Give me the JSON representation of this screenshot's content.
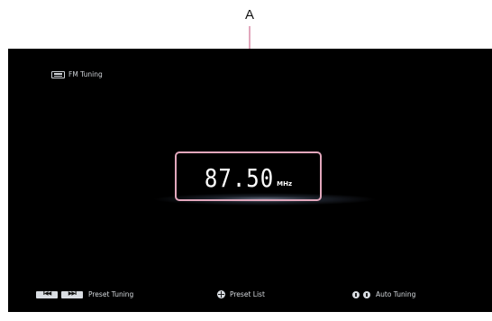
{
  "callout": {
    "letter": "A"
  },
  "mode": {
    "icon": "fm-tuner-icon",
    "label": "FM Tuning"
  },
  "frequency": {
    "value": "87.50",
    "unit": "MHz"
  },
  "footer": {
    "preset_tuning": {
      "keys": [
        "skip-previous-icon",
        "skip-next-icon"
      ],
      "key_glyphs": [
        "I◀◀",
        "▶▶I"
      ],
      "label": "Preset Tuning"
    },
    "preset_list": {
      "icon": "directional-pad-icon",
      "label": "Preset List"
    },
    "auto_tuning": {
      "icons": [
        "tune-down-button-icon",
        "tune-up-button-icon"
      ],
      "label": "Auto Tuning"
    }
  },
  "colors": {
    "background": "#000000",
    "callout_highlight": "#e2a7bc",
    "text": "#ffffff"
  }
}
